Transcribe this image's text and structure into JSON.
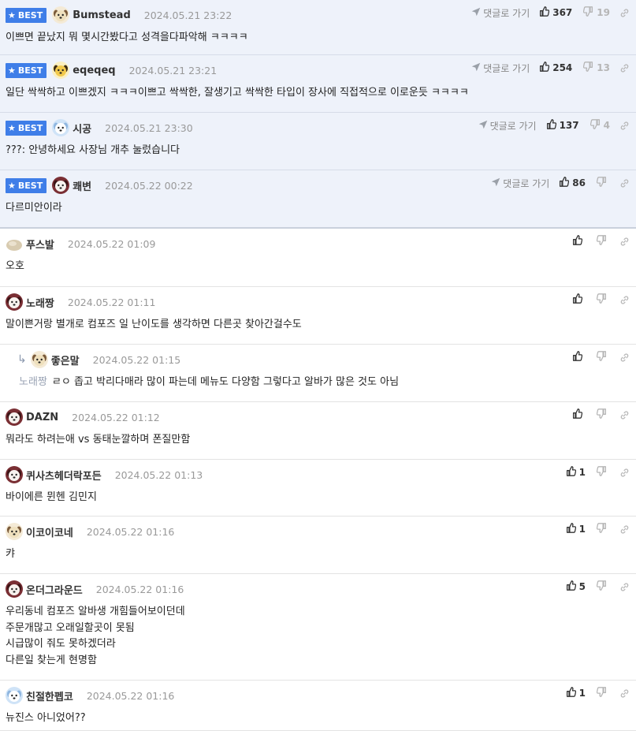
{
  "best_badge": "BEST",
  "goto_label": "댓글로 가기",
  "comments": [
    {
      "nick": "Bumstead",
      "date": "2024.05.21 23:22",
      "text": "이쁘면 끝났지 뭐 몇시간봤다고 성격을다파악해 ㅋㅋㅋㅋ",
      "up": "367",
      "down": "19",
      "best": true,
      "avatar": "dog-tan"
    },
    {
      "nick": "eqeqeq",
      "date": "2024.05.21 23:21",
      "text": "일단 싹싹하고 이쁘겠지 ㅋㅋㅋ이쁘고 싹싹한, 잘생기고 싹싹한 타입이 장사에 직접적으로 이로운듯 ㅋㅋㅋㅋ",
      "up": "254",
      "down": "13",
      "best": true,
      "avatar": "dog-yellow"
    },
    {
      "nick": "시공",
      "date": "2024.05.21 23:30",
      "text": "???: 안녕하세요 사장님 개추 눌렀습니다",
      "up": "137",
      "down": "4",
      "best": true,
      "avatar": "dog-white"
    },
    {
      "nick": "쾌변",
      "date": "2024.05.22 00:22",
      "text": "다르미안이라",
      "up": "86",
      "down": "",
      "best": true,
      "avatar": "dog-red"
    },
    {
      "nick": "푸스발",
      "date": "2024.05.22 01:09",
      "text": "오호",
      "up": "",
      "down": "",
      "best": false,
      "avatar": "blob"
    },
    {
      "nick": "노래짱",
      "date": "2024.05.22 01:11",
      "text": "말이쁜거랑 별개로 컴포즈 일 난이도를 생각하면 다른곳 찾아간걸수도",
      "up": "",
      "down": "",
      "best": false,
      "avatar": "dog-red"
    },
    {
      "nick": "좋은말",
      "date": "2024.05.22 01:15",
      "reply_to": "노래짱",
      "text": "ㄹㅇ 좁고 박리다매라 많이 파는데 메뉴도 다양함 그렇다고 알바가 많은 것도 아님",
      "up": "",
      "down": "",
      "best": false,
      "reply": true,
      "avatar": "dog-tan"
    },
    {
      "nick": "DAZN",
      "date": "2024.05.22 01:12",
      "text": "뭐라도 하려는애 vs 동태눈깔하며 폰질만함",
      "up": "",
      "down": "",
      "best": false,
      "avatar": "dog-red"
    },
    {
      "nick": "퀴사츠헤더락포든",
      "date": "2024.05.22 01:13",
      "text": "바이에른 뮌헨 김민지",
      "up": "1",
      "down": "",
      "best": false,
      "avatar": "dog-red"
    },
    {
      "nick": "이코이코네",
      "date": "2024.05.22 01:16",
      "text": "캬",
      "up": "1",
      "down": "",
      "best": false,
      "avatar": "dog-tan"
    },
    {
      "nick": "온더그라운드",
      "date": "2024.05.22 01:16",
      "text": "우리동네 컴포즈 알바생 개힘들어보이던데\n주문개많고 오래일할곳이 못됨\n시급많이 줘도 못하겠더라\n다른일 찾는게 현명함",
      "up": "5",
      "down": "",
      "best": false,
      "avatar": "dog-red"
    },
    {
      "nick": "친절한펩코",
      "date": "2024.05.22 01:16",
      "text": "뉴진스 아니었어??",
      "up": "1",
      "down": "",
      "best": false,
      "avatar": "dog-white"
    }
  ]
}
